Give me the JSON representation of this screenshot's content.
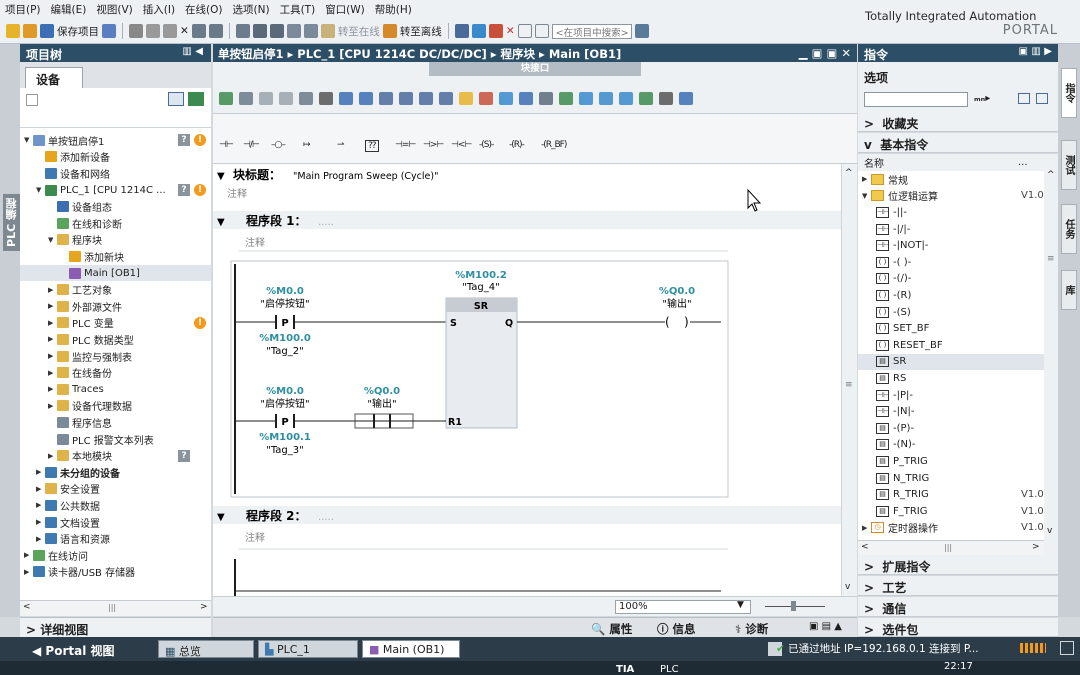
{
  "menu": [
    "项目(P)",
    "编辑(E)",
    "视图(V)",
    "插入(I)",
    "在线(O)",
    "选项(N)",
    "工具(T)",
    "窗口(W)",
    "帮助(H)"
  ],
  "toolbar": {
    "save": "保存项目",
    "online": "转至在线",
    "offline": "转至离线",
    "search_placeholder": "<在项目中搜索>"
  },
  "brand": {
    "line1": "Totally Integrated Automation",
    "line2": "PORTAL"
  },
  "side_tab": "PLC 编程",
  "project_tree": {
    "title": "项目树",
    "tab": "设备",
    "items": [
      {
        "t": "单按钮启停1",
        "lv": 0,
        "ex": "▼",
        "ic": "#6e94c9",
        "q": true,
        "w": true
      },
      {
        "t": "添加新设备",
        "lv": 1,
        "ex": "",
        "ic": "#e6a51c"
      },
      {
        "t": "设备和网络",
        "lv": 1,
        "ex": "",
        "ic": "#3e7ab0"
      },
      {
        "t": "PLC_1 [CPU 1214C ...",
        "lv": 1,
        "ex": "▼",
        "ic": "#3c8a4d",
        "q": true,
        "w": true
      },
      {
        "t": "设备组态",
        "lv": 2,
        "ex": "",
        "ic": "#3b6fb1"
      },
      {
        "t": "在线和诊断",
        "lv": 2,
        "ex": "",
        "ic": "#5aa45c"
      },
      {
        "t": "程序块",
        "lv": 2,
        "ex": "▼",
        "ic": "#e0b24a"
      },
      {
        "t": "添加新块",
        "lv": 3,
        "ex": "",
        "ic": "#e6a51c"
      },
      {
        "t": "Main [OB1]",
        "lv": 3,
        "ex": "",
        "ic": "#8c5bb3",
        "sel": true
      },
      {
        "t": "工艺对象",
        "lv": 2,
        "ex": "▶",
        "ic": "#e0b24a"
      },
      {
        "t": "外部源文件",
        "lv": 2,
        "ex": "▶",
        "ic": "#e0b24a"
      },
      {
        "t": "PLC 变量",
        "lv": 2,
        "ex": "▶",
        "ic": "#e0b24a",
        "w": true
      },
      {
        "t": "PLC 数据类型",
        "lv": 2,
        "ex": "▶",
        "ic": "#e0b24a"
      },
      {
        "t": "监控与强制表",
        "lv": 2,
        "ex": "▶",
        "ic": "#e0b24a"
      },
      {
        "t": "在线备份",
        "lv": 2,
        "ex": "▶",
        "ic": "#e0b24a"
      },
      {
        "t": "Traces",
        "lv": 2,
        "ex": "▶",
        "ic": "#e0b24a"
      },
      {
        "t": "设备代理数据",
        "lv": 2,
        "ex": "▶",
        "ic": "#e0b24a"
      },
      {
        "t": "程序信息",
        "lv": 2,
        "ex": "",
        "ic": "#7a8a99"
      },
      {
        "t": "PLC 报警文本列表",
        "lv": 2,
        "ex": "",
        "ic": "#7a8a99"
      },
      {
        "t": "本地模块",
        "lv": 2,
        "ex": "▶",
        "ic": "#e0b24a",
        "q": true
      },
      {
        "t": "未分组的设备",
        "lv": 1,
        "ex": "▶",
        "ic": "#3e7ab0",
        "b": true
      },
      {
        "t": "安全设置",
        "lv": 1,
        "ex": "▶",
        "ic": "#e0b24a"
      },
      {
        "t": "公共数据",
        "lv": 1,
        "ex": "▶",
        "ic": "#3e7ab0"
      },
      {
        "t": "文档设置",
        "lv": 1,
        "ex": "▶",
        "ic": "#3e7ab0"
      },
      {
        "t": "语言和资源",
        "lv": 1,
        "ex": "▶",
        "ic": "#3e7ab0"
      },
      {
        "t": "在线访问",
        "lv": 0,
        "ex": "▶",
        "ic": "#5aa45c"
      },
      {
        "t": "读卡器/USB 存储器",
        "lv": 0,
        "ex": "▶",
        "ic": "#3e7ab0"
      }
    ],
    "details": "详细视图"
  },
  "editor": {
    "breadcrumb": "单按钮启停1 ▸ PLC_1 [CPU 1214C DC/DC/DC] ▸ 程序块 ▸ Main [OB1]",
    "block_interface": "块接口",
    "block_title_label": "块标题：",
    "block_title_value": "\"Main Program Sweep (Cycle)\"",
    "comment": "注释",
    "network1": "程序段 1：",
    "network2": "程序段 2：",
    "dots": ".....",
    "zoom": "100%"
  },
  "ladder": {
    "c1_addr": "%M0.0",
    "c1_name": "\"启停按钮\"",
    "c1_sub_addr": "%M100.0",
    "c1_sub_name": "\"Tag_2\"",
    "sr_addr": "%M100.2",
    "sr_name": "\"Tag_4\"",
    "sr_type": "SR",
    "sr_s": "S",
    "sr_q": "Q",
    "sr_r1": "R1",
    "out_addr": "%Q0.0",
    "out_name": "\"输出\"",
    "c2_addr": "%M0.0",
    "c2_name": "\"启停按钮\"",
    "c2_sub_addr": "%M100.1",
    "c2_sub_name": "\"Tag_3\"",
    "c3_addr": "%Q0.0",
    "c3_name": "\"输出\"",
    "p_label": "P"
  },
  "instructions": {
    "title": "指令",
    "options": "选项",
    "favorites": "收藏夹",
    "basic": "基本指令",
    "col_name": "名称",
    "col_more": "...",
    "items": [
      {
        "n": "常规",
        "ex": "▶",
        "ic": "folder",
        "v": "",
        "lv": 0
      },
      {
        "n": "位逻辑运算",
        "ex": "▼",
        "ic": "folder",
        "v": "V1.0",
        "lv": 0
      },
      {
        "n": "-||-",
        "ic": "c",
        "v": "",
        "lv": 1
      },
      {
        "n": "-|/|-",
        "ic": "c",
        "v": "",
        "lv": 1
      },
      {
        "n": "-|NOT|-",
        "ic": "c",
        "v": "",
        "lv": 1
      },
      {
        "n": "-( )-",
        "ic": "o",
        "v": "",
        "lv": 1
      },
      {
        "n": "-(/)-",
        "ic": "o",
        "v": "",
        "lv": 1
      },
      {
        "n": "-(R)",
        "ic": "o",
        "v": "",
        "lv": 1
      },
      {
        "n": "-(S)",
        "ic": "o",
        "v": "",
        "lv": 1
      },
      {
        "n": "SET_BF",
        "ic": "o",
        "v": "",
        "lv": 1
      },
      {
        "n": "RESET_BF",
        "ic": "o",
        "v": "",
        "lv": 1
      },
      {
        "n": "SR",
        "ic": "b",
        "v": "",
        "lv": 1,
        "sel": true
      },
      {
        "n": "RS",
        "ic": "b",
        "v": "",
        "lv": 1
      },
      {
        "n": "-|P|-",
        "ic": "c",
        "v": "",
        "lv": 1
      },
      {
        "n": "-|N|-",
        "ic": "c",
        "v": "",
        "lv": 1
      },
      {
        "n": "-(P)-",
        "ic": "b",
        "v": "",
        "lv": 1
      },
      {
        "n": "-(N)-",
        "ic": "b",
        "v": "",
        "lv": 1
      },
      {
        "n": "P_TRIG",
        "ic": "b",
        "v": "",
        "lv": 1
      },
      {
        "n": "N_TRIG",
        "ic": "b",
        "v": "",
        "lv": 1
      },
      {
        "n": "R_TRIG",
        "ic": "b",
        "v": "V1.0",
        "lv": 1
      },
      {
        "n": "F_TRIG",
        "ic": "b",
        "v": "V1.0",
        "lv": 1
      },
      {
        "n": "定时器操作",
        "ex": "▶",
        "ic": "timer",
        "v": "V1.0",
        "lv": 0
      }
    ],
    "extended": "扩展指令",
    "technology": "工艺",
    "communication": "通信",
    "optional": "选件包"
  },
  "right_tabs": [
    "指令",
    "测试",
    "任务",
    "库"
  ],
  "props_bar": {
    "properties": "属性",
    "info": "信息",
    "diagnostics": "诊断"
  },
  "portal": {
    "view": "Portal 视图",
    "overview": "总览",
    "plc": "PLC_1",
    "main": "Main (OB1)",
    "status": "已通过地址 IP=192.168.0.1 连接到 P..."
  },
  "taskbar": {
    "time": "22:17",
    "app": "TIA",
    "plc": "PLC"
  }
}
